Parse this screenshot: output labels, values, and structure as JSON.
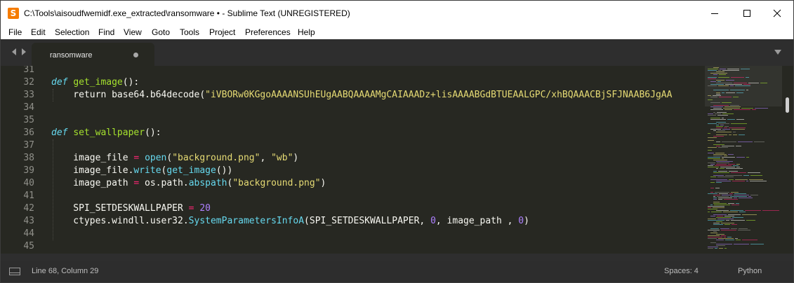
{
  "window": {
    "title": "C:\\Tools\\aisoudfwemidf.exe_extracted\\ransomware • - Sublime Text (UNREGISTERED)",
    "app_icon": "sublime-text-logo"
  },
  "menu": [
    "File",
    "Edit",
    "Selection",
    "Find",
    "View",
    "Goto",
    "Tools",
    "Project",
    "Preferences",
    "Help"
  ],
  "tabs": [
    {
      "label": "ransomware",
      "modified": true
    }
  ],
  "editor": {
    "line_numbers": [
      "31",
      "32",
      "33",
      "34",
      "35",
      "36",
      "37",
      "38",
      "39",
      "40",
      "41",
      "42",
      "43",
      "44",
      "45"
    ],
    "tokens": {
      "def": "def",
      "get_image": "get_image",
      "paren_colon": "():",
      "return": "    return base64.b64decode(",
      "b64": "\"iVBORw0KGgoAAAANSUhEUgAABQAAAAMgCAIAAADz+lisAAAABGdBTUEAALGPC/xhBQAAACBjSFJNAAB6JgAA",
      "set_wallpaper": "set_wallpaper",
      "l38_a": "    image_file ",
      "eq": "=",
      "open": "open",
      "l38_b": "(",
      "bg_png": "\"background.png\"",
      "comma": ", ",
      "wb": "\"wb\"",
      "close_paren": ")",
      "l39_a": "    image_file.",
      "write": "write",
      "l39_b": "(",
      "l39_c": "())",
      "l40_a": "    image_path ",
      "l40_b": " os.path.",
      "abspath": "abspath",
      "l42_a": "    SPI_SETDESKWALLPAPER ",
      "twenty": "20",
      "l43_a": "    ctypes.windll.user32.",
      "sysparams": "SystemParametersInfoA",
      "l43_b": "(SPI_SETDESKWALLPAPER, ",
      "zero_a": "0",
      "l43_c": ", image_path , ",
      "zero_b": "0"
    }
  },
  "status": {
    "position": "Line 68, Column 29",
    "spaces": "Spaces: 4",
    "syntax": "Python"
  },
  "colors": {
    "editor_bg": "#272822",
    "keyword": "#66d9ef",
    "function": "#a6e22e",
    "string": "#e6db74",
    "number": "#ae81ff",
    "operator": "#f92672"
  }
}
